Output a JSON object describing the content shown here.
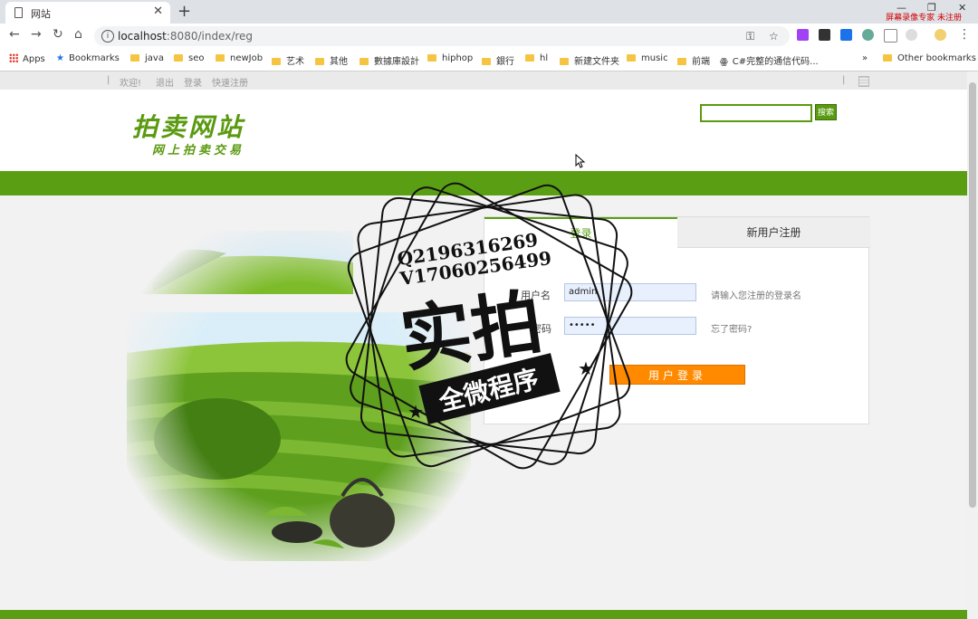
{
  "browser": {
    "tab_title": "网站",
    "url_host": "localhost",
    "url_rest": ":8080/index/reg",
    "recorder_text": "屏幕录像专家 未注册",
    "bookmarks": [
      "Apps",
      "Bookmarks",
      "java",
      "seo",
      "newJob",
      "艺术",
      "其他",
      "數據庫設計",
      "hiphop",
      "銀行",
      "hl",
      "新建文件夹",
      "music",
      "前端",
      "C#完整的通信代码...",
      "»",
      "Other bookmarks"
    ]
  },
  "topbar": {
    "welcome": "欢迎!",
    "logout": "退出",
    "login": "登录",
    "quick_register": "快速注册"
  },
  "header": {
    "logo_main": "拍卖网站",
    "logo_sub": "网上拍卖交易",
    "search_button": "搜索"
  },
  "login": {
    "tab_login": "登录",
    "tab_register": "新用户注册",
    "username_label": "用户名",
    "username_value": "admin",
    "username_hint": "请输入您注册的登录名",
    "password_label": "密码",
    "password_value": "•••••",
    "password_hint": "忘了密码?",
    "submit_label": "用户登录"
  },
  "watermark": {
    "line1": "Q2196316269",
    "line2": "V17060256499",
    "main": "实拍",
    "banner": "全微程序"
  },
  "colors": {
    "brand_green": "#5a9f13",
    "button_orange": "#ff8a00"
  }
}
